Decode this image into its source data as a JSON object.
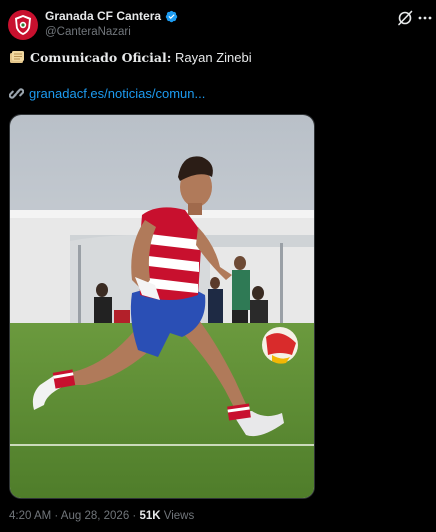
{
  "author": {
    "name": "Granada CF Cantera",
    "handle": "@CanteraNazari"
  },
  "tweet": {
    "line1_bold": "Comunicado Oficial:",
    "line1_rest": " Rayan Zinebi",
    "link_text": "granadacf.es/noticias/comun..."
  },
  "icons": {
    "scroll": "scroll-emoji",
    "link": "link-emoji",
    "verified": "verified-badge-icon",
    "grok": "grok-icon",
    "more": "more-icon"
  },
  "meta": {
    "time": "4:20 AM",
    "date": "Aug 28, 2026",
    "views_count": "51K",
    "views_label": "Views"
  },
  "colors": {
    "background": "#000000",
    "text": "#e7e9ea",
    "muted": "#71767b",
    "link": "#1d9bf0",
    "verified": "#1d9bf0",
    "brand_red": "#c8102e"
  }
}
